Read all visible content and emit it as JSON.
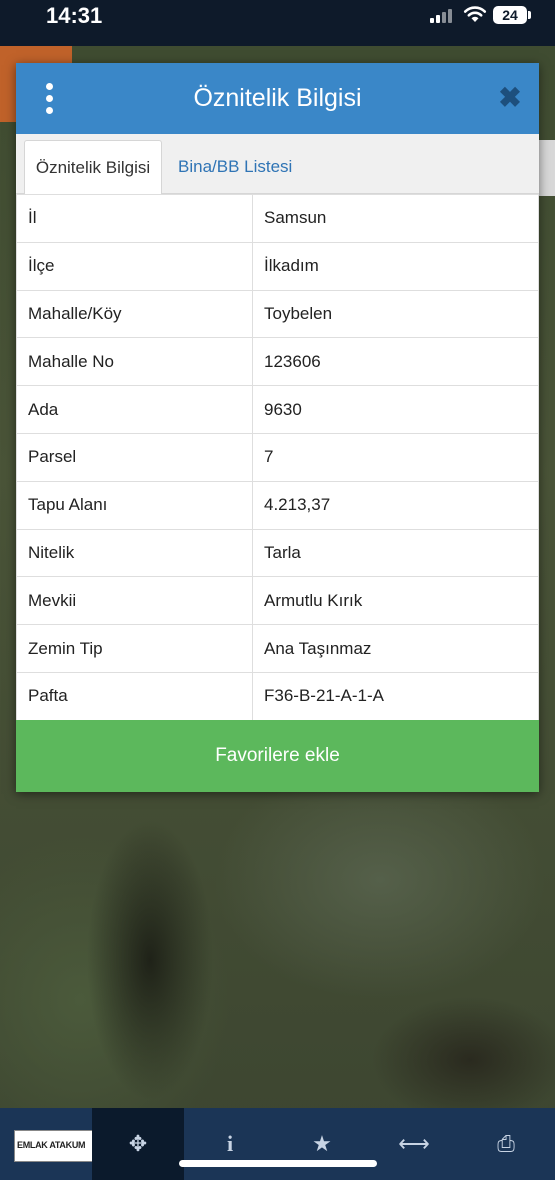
{
  "status_bar": {
    "time": "14:31",
    "battery": "24"
  },
  "dialog": {
    "title": "Öznitelik Bilgisi",
    "close_symbol": "✖",
    "tabs": [
      {
        "label": "Öznitelik Bilgisi",
        "active": true
      },
      {
        "label": "Bina/BB Listesi",
        "active": false
      }
    ],
    "rows": [
      {
        "key": "İl",
        "value": "Samsun"
      },
      {
        "key": "İlçe",
        "value": "İlkadım"
      },
      {
        "key": "Mahalle/Köy",
        "value": "Toybelen"
      },
      {
        "key": "Mahalle No",
        "value": "123606"
      },
      {
        "key": "Ada",
        "value": "9630"
      },
      {
        "key": "Parsel",
        "value": "7"
      },
      {
        "key": "Tapu Alanı",
        "value": "4.213,37"
      },
      {
        "key": "Nitelik",
        "value": "Tarla"
      },
      {
        "key": "Mevkii",
        "value": "Armutlu Kırık"
      },
      {
        "key": "Zemin Tip",
        "value": "Ana Taşınmaz"
      },
      {
        "key": "Pafta",
        "value": "F36-B-21-A-1-A"
      }
    ],
    "favorite_button": "Favorilere ekle"
  },
  "toolbar": {
    "logo_text": "EMLAK ATAKUM",
    "items": [
      {
        "icon": "logo"
      },
      {
        "icon": "crosshair-icon",
        "glyph": "✥",
        "active": true
      },
      {
        "icon": "info-icon",
        "glyph": "i"
      },
      {
        "icon": "star-icon",
        "glyph": "★"
      },
      {
        "icon": "measure-icon",
        "glyph": "⟷"
      },
      {
        "icon": "print-icon",
        "glyph": "⎙"
      }
    ]
  },
  "colors": {
    "header_blue": "#3a87c8",
    "button_green": "#5cb85c",
    "tab_link": "#2f74b5",
    "toolbar": "#1b3556"
  }
}
